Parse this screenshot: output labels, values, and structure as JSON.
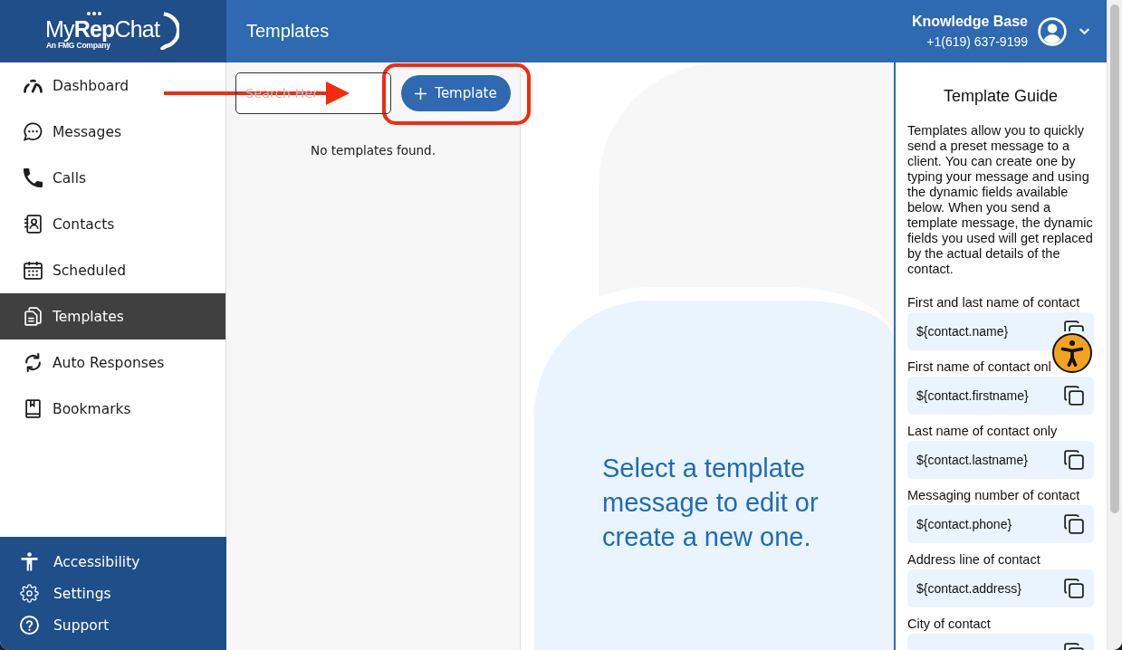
{
  "logo": {
    "wordmark": "My**Rep**Chat",
    "tagline": "An FMG Company"
  },
  "header": {
    "title": "Templates",
    "account_name": "Knowledge Base",
    "account_phone": "+1(619) 637-9199"
  },
  "sidebar": {
    "items": [
      {
        "label": "Dashboard",
        "selected": false
      },
      {
        "label": "Messages",
        "selected": false
      },
      {
        "label": "Calls",
        "selected": false
      },
      {
        "label": "Contacts",
        "selected": false
      },
      {
        "label": "Scheduled",
        "selected": false
      },
      {
        "label": "Templates",
        "selected": true
      },
      {
        "label": "Auto Responses",
        "selected": false
      },
      {
        "label": "Bookmarks",
        "selected": false
      }
    ],
    "footer_items": [
      {
        "label": "Accessibility"
      },
      {
        "label": "Settings"
      },
      {
        "label": "Support"
      }
    ]
  },
  "template_list": {
    "search": {
      "placeholder": "Search Her"
    },
    "add_button": {
      "label": "Template"
    },
    "empty_message": "No templates found."
  },
  "editor": {
    "prompt": "Select a template message to edit or create a new one."
  },
  "guide": {
    "title": "Template Guide",
    "intro": "Templates allow you to quickly send a preset message to a client. You can create one by typing your message and using the dynamic fields available below. When you send a template message, the dynamic fields you used will get replaced by the actual details of the contact.",
    "fields": [
      {
        "label": "First and last name of contact",
        "value": "${contact.name}"
      },
      {
        "label": "First name of contact onl",
        "value": "${contact.firstname}"
      },
      {
        "label": "Last name of contact only",
        "value": "${contact.lastname}"
      },
      {
        "label": "Messaging number of contact",
        "value": "${contact.phone}"
      },
      {
        "label": "Address line of contact",
        "value": "${contact.address}"
      },
      {
        "label": "City of contact"
      }
    ]
  },
  "annotations": [
    {
      "kind": "arrow"
    },
    {
      "kind": "outline"
    }
  ]
}
